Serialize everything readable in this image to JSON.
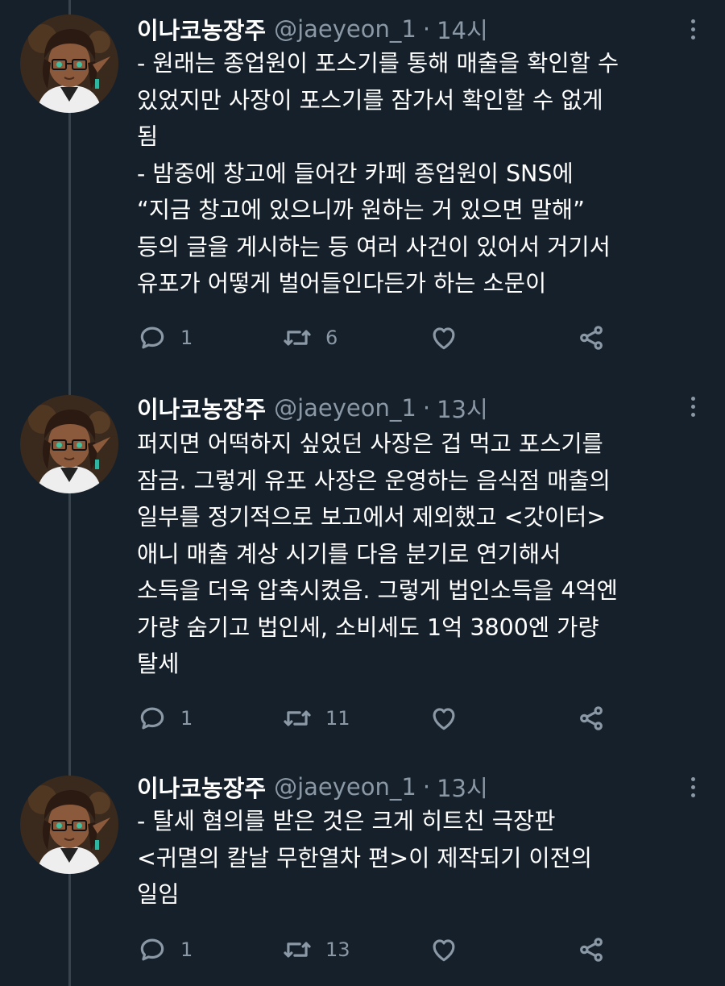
{
  "tweets": [
    {
      "name": "이나코농장주",
      "handle": "@jaeyeon_1",
      "separator": "·",
      "time": "14시",
      "lines": [
        "- 원래는 종업원이 포스기를 통해 매출을 확인할 수",
        "있었지만 사장이 포스기를 잠가서 확인할 수 없게",
        "됨",
        "- 밤중에 창고에 들어간 카페 종업원이 SNS에",
        "“지금 창고에 있으니까 원하는 거 있으면 말해”",
        "등의 글을 게시하는 등 여러 사건이 있어서 거기서",
        "유포가 어떻게 벌어들인다든가 하는 소문이"
      ],
      "replies": "1",
      "retweets": "6"
    },
    {
      "name": "이나코농장주",
      "handle": "@jaeyeon_1",
      "separator": "·",
      "time": "13시",
      "lines": [
        "퍼지면 어떡하지 싶었던 사장은 겁 먹고 포스기를",
        "잠금. 그렇게 유포 사장은 운영하는 음식점 매출의",
        "일부를 정기적으로 보고에서 제외했고 <갓이터>",
        "애니 매출 계상 시기를 다음 분기로 연기해서",
        "소득을 더욱 압축시켰음. 그렇게 법인소득을 4억엔",
        "가량 숨기고 법인세, 소비세도 1억 3800엔 가량",
        "탈세"
      ],
      "replies": "1",
      "retweets": "11"
    },
    {
      "name": "이나코농장주",
      "handle": "@jaeyeon_1",
      "separator": "·",
      "time": "13시",
      "lines": [
        "- 탈세 혐의를 받은 것은 크게 히트친 극장판",
        "<귀멸의 칼날 무한열차 편>이 제작되기 이전의",
        "일임"
      ],
      "replies": "1",
      "retweets": "13"
    }
  ],
  "icons": {
    "reply": "reply-icon",
    "retweet": "retweet-icon",
    "like": "heart-icon",
    "share": "share-icon",
    "more": "more-vertical-icon"
  },
  "colors": {
    "background": "#15202b",
    "text": "#ffffff",
    "secondary": "#8b98a5",
    "thread_line": "#38444d"
  }
}
